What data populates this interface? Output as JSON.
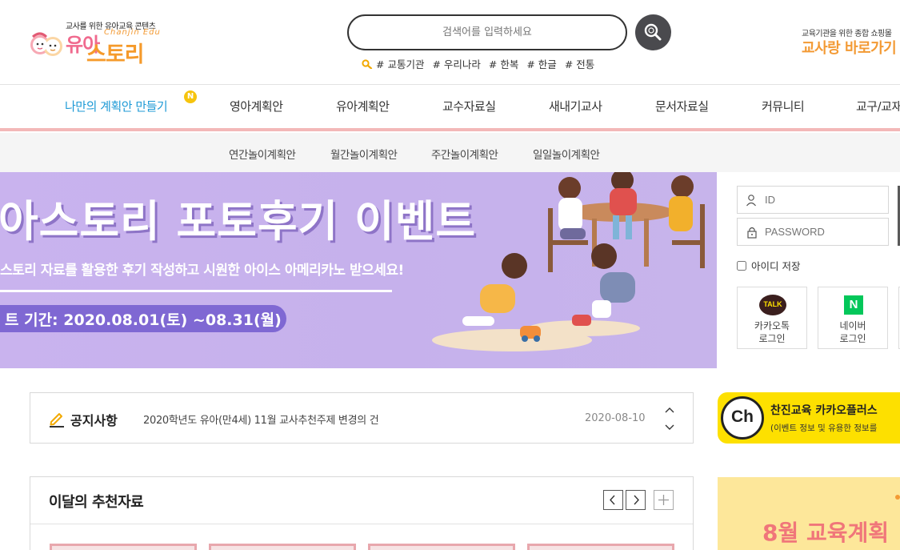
{
  "header": {
    "logo": {
      "tagline": "교사를 위한 유아교육 콘텐츠",
      "name_part1": "유아",
      "name_part2": "스토리",
      "english": "Chanjin Edu"
    },
    "search": {
      "placeholder": "검색어를 입력하세요",
      "tags": [
        "# 교통기관",
        "# 우리나라",
        "# 한복",
        "# 한글",
        "# 전통"
      ]
    },
    "shop": {
      "tagline": "교육기관을 위한 종합 쇼핑몰",
      "link_text": "교사랑 바로가기"
    }
  },
  "nav": {
    "items": [
      "나만의 계획안 만들기",
      "영아계획안",
      "유아계획안",
      "교수자료실",
      "새내기교사",
      "문서자료실",
      "커뮤니티",
      "교구/교재"
    ],
    "badge": "N",
    "sub_items": [
      "연간놀이계획안",
      "월간놀이계획안",
      "주간놀이계획안",
      "일일놀이계획안"
    ]
  },
  "banner": {
    "title": "아스토리 포토후기 이벤트",
    "subtitle": "스토리 자료를 활용한 후기 작성하고 시원한 아이스 아메리카노 받으세요!",
    "period": "트 기간: 2020.08.01(토) ~08.31(월)"
  },
  "login": {
    "id_placeholder": "ID",
    "password_placeholder": "PASSWORD",
    "save_id_label": "아이디 저장",
    "kakao_badge": "TALK",
    "kakao_label_1": "카카오톡",
    "kakao_label_2": "로그인",
    "naver_badge": "N",
    "naver_label_1": "네이버",
    "naver_label_2": "로그인"
  },
  "notice": {
    "title": "공지사항",
    "text": "2020학년도 유아(만4세) 11월 교사추천주제 변경의 건",
    "date": "2020-08-10"
  },
  "recommended": {
    "title": "이달의 추천자료"
  },
  "side_ads": {
    "kakao_plus": {
      "logo_text": "Ch",
      "title": "찬진교육 카카오플러스",
      "subtitle": "(이벤트 정보 및 유용한 정보를"
    },
    "monthly": {
      "title": "8월 교육계획"
    }
  },
  "colors": {
    "accent_blue": "#1e9ad6",
    "pink_bar": "#f3b8b8",
    "banner_purple": "#c9b3ee",
    "pill_purple": "#7f68d3",
    "kakao_yellow": "#fde000",
    "naver_green": "#03c75a",
    "logo_orange": "#f39a34",
    "logo_pink": "#f06a8e"
  },
  "icons": [
    "search-icon",
    "pencil-icon",
    "user-icon",
    "lock-icon",
    "chevron-up-icon",
    "chevron-down-icon",
    "chevron-left-icon",
    "chevron-right-icon",
    "plus-icon"
  ]
}
